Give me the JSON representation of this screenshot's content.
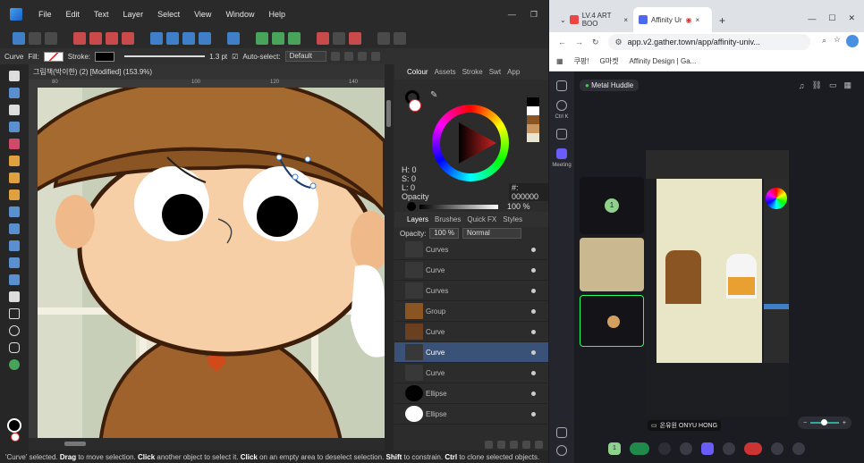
{
  "menu": {
    "items": [
      "File",
      "Edit",
      "Text",
      "Layer",
      "Select",
      "View",
      "Window",
      "Help"
    ]
  },
  "context": {
    "tool": "Curve",
    "fill_label": "Fill:",
    "stroke_label": "Stroke:",
    "stroke_width": "1.3 pt",
    "autoselect_label": "Auto-select:",
    "autoselect_value": "Default"
  },
  "document": {
    "title": "그림책(박이한) (2) [Modified] (153.9%)"
  },
  "ruler": {
    "ticks": [
      "80",
      "100",
      "120",
      "140"
    ]
  },
  "color_panel": {
    "tabs": [
      "Colour",
      "Assets",
      "Stroke",
      "Swt",
      "App"
    ],
    "h": "H: 0",
    "s": "S: 0",
    "l": "L: 0",
    "hex": "#: 000000",
    "opacity_label": "Opacity",
    "opacity_value": "100 %"
  },
  "layers_panel": {
    "tabs": [
      "Layers",
      "Brushes",
      "Quick FX",
      "Styles"
    ],
    "opacity_label": "Opacity:",
    "opacity_value": "100 %",
    "blend": "Normal",
    "rows": [
      {
        "name": "Curves"
      },
      {
        "name": "Curve"
      },
      {
        "name": "Curves"
      },
      {
        "name": "Group"
      },
      {
        "name": "Curve"
      },
      {
        "name": "Curve"
      },
      {
        "name": "Curve"
      },
      {
        "name": "Ellipse"
      },
      {
        "name": "Ellipse"
      }
    ]
  },
  "status": {
    "text1": "'Curve' selected. ",
    "drag": "Drag",
    "text2": " to move selection. ",
    "click": "Click",
    "text3": " another object to select it. ",
    "click2": "Click",
    "text4": " on an empty area to deselect selection. ",
    "shift": "Shift",
    "text5": " to constrain. ",
    "ctrl": "Ctrl",
    "text6": " to clone selected objects."
  },
  "browser": {
    "tabs": [
      {
        "label": "LV.4 ART BOO"
      },
      {
        "label": "Affinity Ur"
      }
    ],
    "url": "app.v2.gather.town/app/affinity-univ...",
    "bookmarks": [
      "쿠팡!",
      "G마켓",
      "Affinity Design | Ga..."
    ]
  },
  "gather": {
    "room": "Metal Huddle",
    "nav": [
      "Ctrl K",
      "Meeting"
    ],
    "count": "1",
    "presenter": "온유원 ONYU HONG",
    "bottom_count": "1"
  },
  "colors": {
    "accent": "#3f7fc7",
    "selected_row": "#3a5278"
  }
}
